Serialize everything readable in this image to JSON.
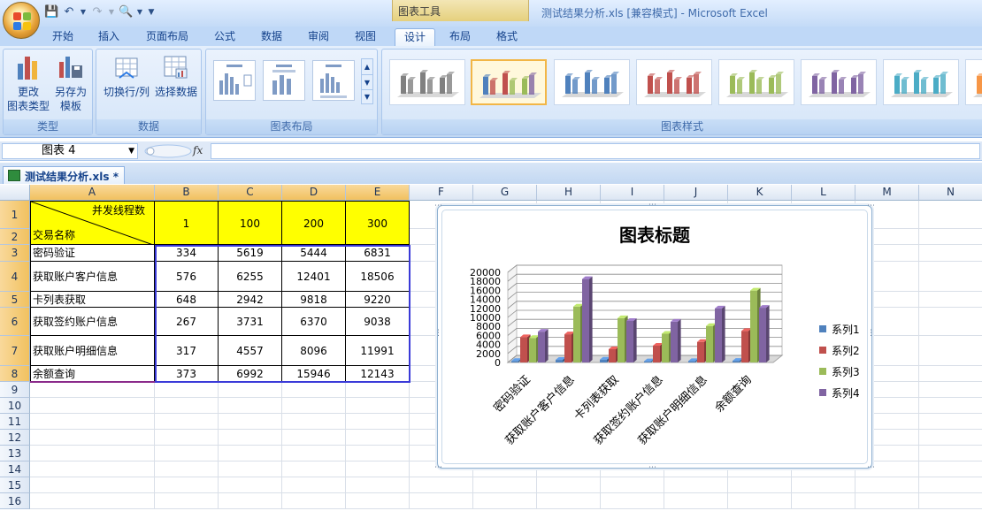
{
  "app": {
    "window_title": "测试结果分析.xls  [兼容模式] - Microsoft Excel",
    "context_tab": "图表工具"
  },
  "tabs": [
    {
      "label": "开始"
    },
    {
      "label": "插入"
    },
    {
      "label": "页面布局"
    },
    {
      "label": "公式"
    },
    {
      "label": "数据"
    },
    {
      "label": "审阅"
    },
    {
      "label": "视图"
    },
    {
      "label": "设计"
    },
    {
      "label": "布局"
    },
    {
      "label": "格式"
    }
  ],
  "ribbon": {
    "type_group": {
      "label": "类型",
      "change_type_l1": "更改",
      "change_type_l2": "图表类型",
      "save_template_l1": "另存为",
      "save_template_l2": "模板"
    },
    "data_group": {
      "label": "数据",
      "switch_label": "切换行/列",
      "select_label": "选择数据"
    },
    "layout_group": {
      "label": "图表布局"
    },
    "styles_group": {
      "label": "图表样式"
    },
    "style_colors": [
      "#808080",
      "#c0504d",
      "#4f81bd",
      "#c0504d",
      "#9bbb59",
      "#8064a2",
      "#4bacc6",
      "#f79646"
    ]
  },
  "formula_bar": {
    "name_box": "图表 4",
    "fx": "fx",
    "formula": ""
  },
  "workbook_tab": {
    "label": "测试结果分析.xls *"
  },
  "sheet": {
    "columns": [
      "A",
      "B",
      "C",
      "D",
      "E",
      "F",
      "G",
      "H",
      "I",
      "J",
      "K",
      "L",
      "M",
      "N"
    ],
    "rows": [
      "1",
      "2",
      "3",
      "4",
      "5",
      "6",
      "7",
      "8",
      "9",
      "10",
      "11",
      "12",
      "13",
      "14",
      "15",
      "16"
    ],
    "header_top": "并发线程数",
    "header_bottom": "交易名称",
    "thread_counts": [
      "1",
      "100",
      "200",
      "300"
    ],
    "data_rows": [
      {
        "name": "密码验证",
        "values": [
          "334",
          "5619",
          "5444",
          "6831"
        ]
      },
      {
        "name": "获取账户客户信息",
        "values": [
          "576",
          "6255",
          "12401",
          "18506"
        ]
      },
      {
        "name": "卡列表获取",
        "values": [
          "648",
          "2942",
          "9818",
          "9220"
        ]
      },
      {
        "name": "获取签约账户信息",
        "values": [
          "267",
          "3731",
          "6370",
          "9038"
        ]
      },
      {
        "name": "获取账户明细信息",
        "values": [
          "317",
          "4557",
          "8096",
          "11991"
        ]
      },
      {
        "name": "余额查询",
        "values": [
          "373",
          "6992",
          "15946",
          "12143"
        ]
      }
    ]
  },
  "chart_data": {
    "type": "bar",
    "title": "图表标题",
    "categories": [
      "密码验证",
      "获取账户客户信息",
      "卡列表获取",
      "获取签约账户信息",
      "获取账户明细信息",
      "余额查询"
    ],
    "series": [
      {
        "name": "系列1",
        "color": "#4f81bd",
        "values": [
          334,
          576,
          648,
          267,
          317,
          373
        ]
      },
      {
        "name": "系列2",
        "color": "#c0504d",
        "values": [
          5619,
          6255,
          2942,
          3731,
          4557,
          6992
        ]
      },
      {
        "name": "系列3",
        "color": "#9bbb59",
        "values": [
          5444,
          12401,
          9818,
          6370,
          8096,
          15946
        ]
      },
      {
        "name": "系列4",
        "color": "#8064a2",
        "values": [
          6831,
          18506,
          9220,
          9038,
          11991,
          12143
        ]
      }
    ],
    "yticks": [
      "0",
      "2000",
      "4000",
      "6000",
      "8000",
      "10000",
      "12000",
      "14000",
      "16000",
      "18000",
      "20000"
    ],
    "ylim": [
      0,
      20000
    ],
    "grid": true,
    "legend": "right",
    "style": "3d-clustered-column"
  }
}
